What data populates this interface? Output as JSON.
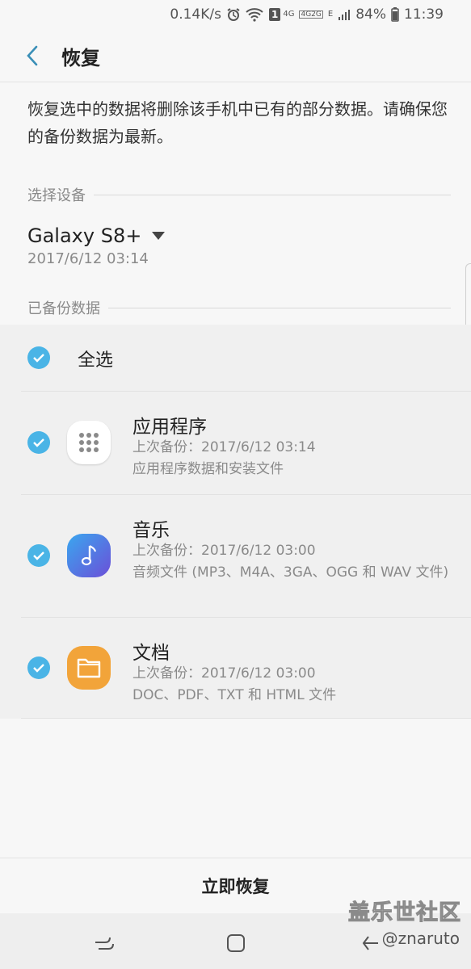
{
  "status_bar": {
    "speed": "0.14K/s",
    "network_4g": "4G",
    "sim_top": "4G",
    "sim_bottom": "2G",
    "data_e": "E",
    "battery": "84%",
    "time": "11:39",
    "sim_slot": "1"
  },
  "header": {
    "title": "恢复"
  },
  "description": "恢复选中的数据将删除该手机中已有的部分数据。请确保您的备份数据为最新。",
  "device_section": {
    "header": "选择设备",
    "device_name": "Galaxy S8+",
    "device_date": "2017/6/12 03:14"
  },
  "backup_section": {
    "header": "已备份数据",
    "select_all": "全选",
    "items": [
      {
        "title": "应用程序",
        "last_backup": "上次备份：2017/6/12 03:14",
        "detail": "应用程序数据和安装文件",
        "icon": "apps-grid-icon",
        "icon_color": "#ffffff"
      },
      {
        "title": "音乐",
        "last_backup": "上次备份：2017/6/12 03:00",
        "detail": "音频文件 (MP3、M4A、3GA、OGG 和 WAV 文件)",
        "icon": "music-note-icon",
        "icon_color": "#5b6ee6"
      },
      {
        "title": "文档",
        "last_backup": "上次备份：2017/6/12 03:00",
        "detail": "DOC、PDF、TXT 和 HTML 文件",
        "icon": "folder-icon",
        "icon_color": "#f2a43a"
      }
    ]
  },
  "restore_button": "立即恢复",
  "watermark": {
    "main": "盖乐世社区",
    "sub": "@znaruto"
  },
  "colors": {
    "accent": "#4ab4e6",
    "background": "#f7f7f7",
    "list_background": "#f0f0f0"
  }
}
